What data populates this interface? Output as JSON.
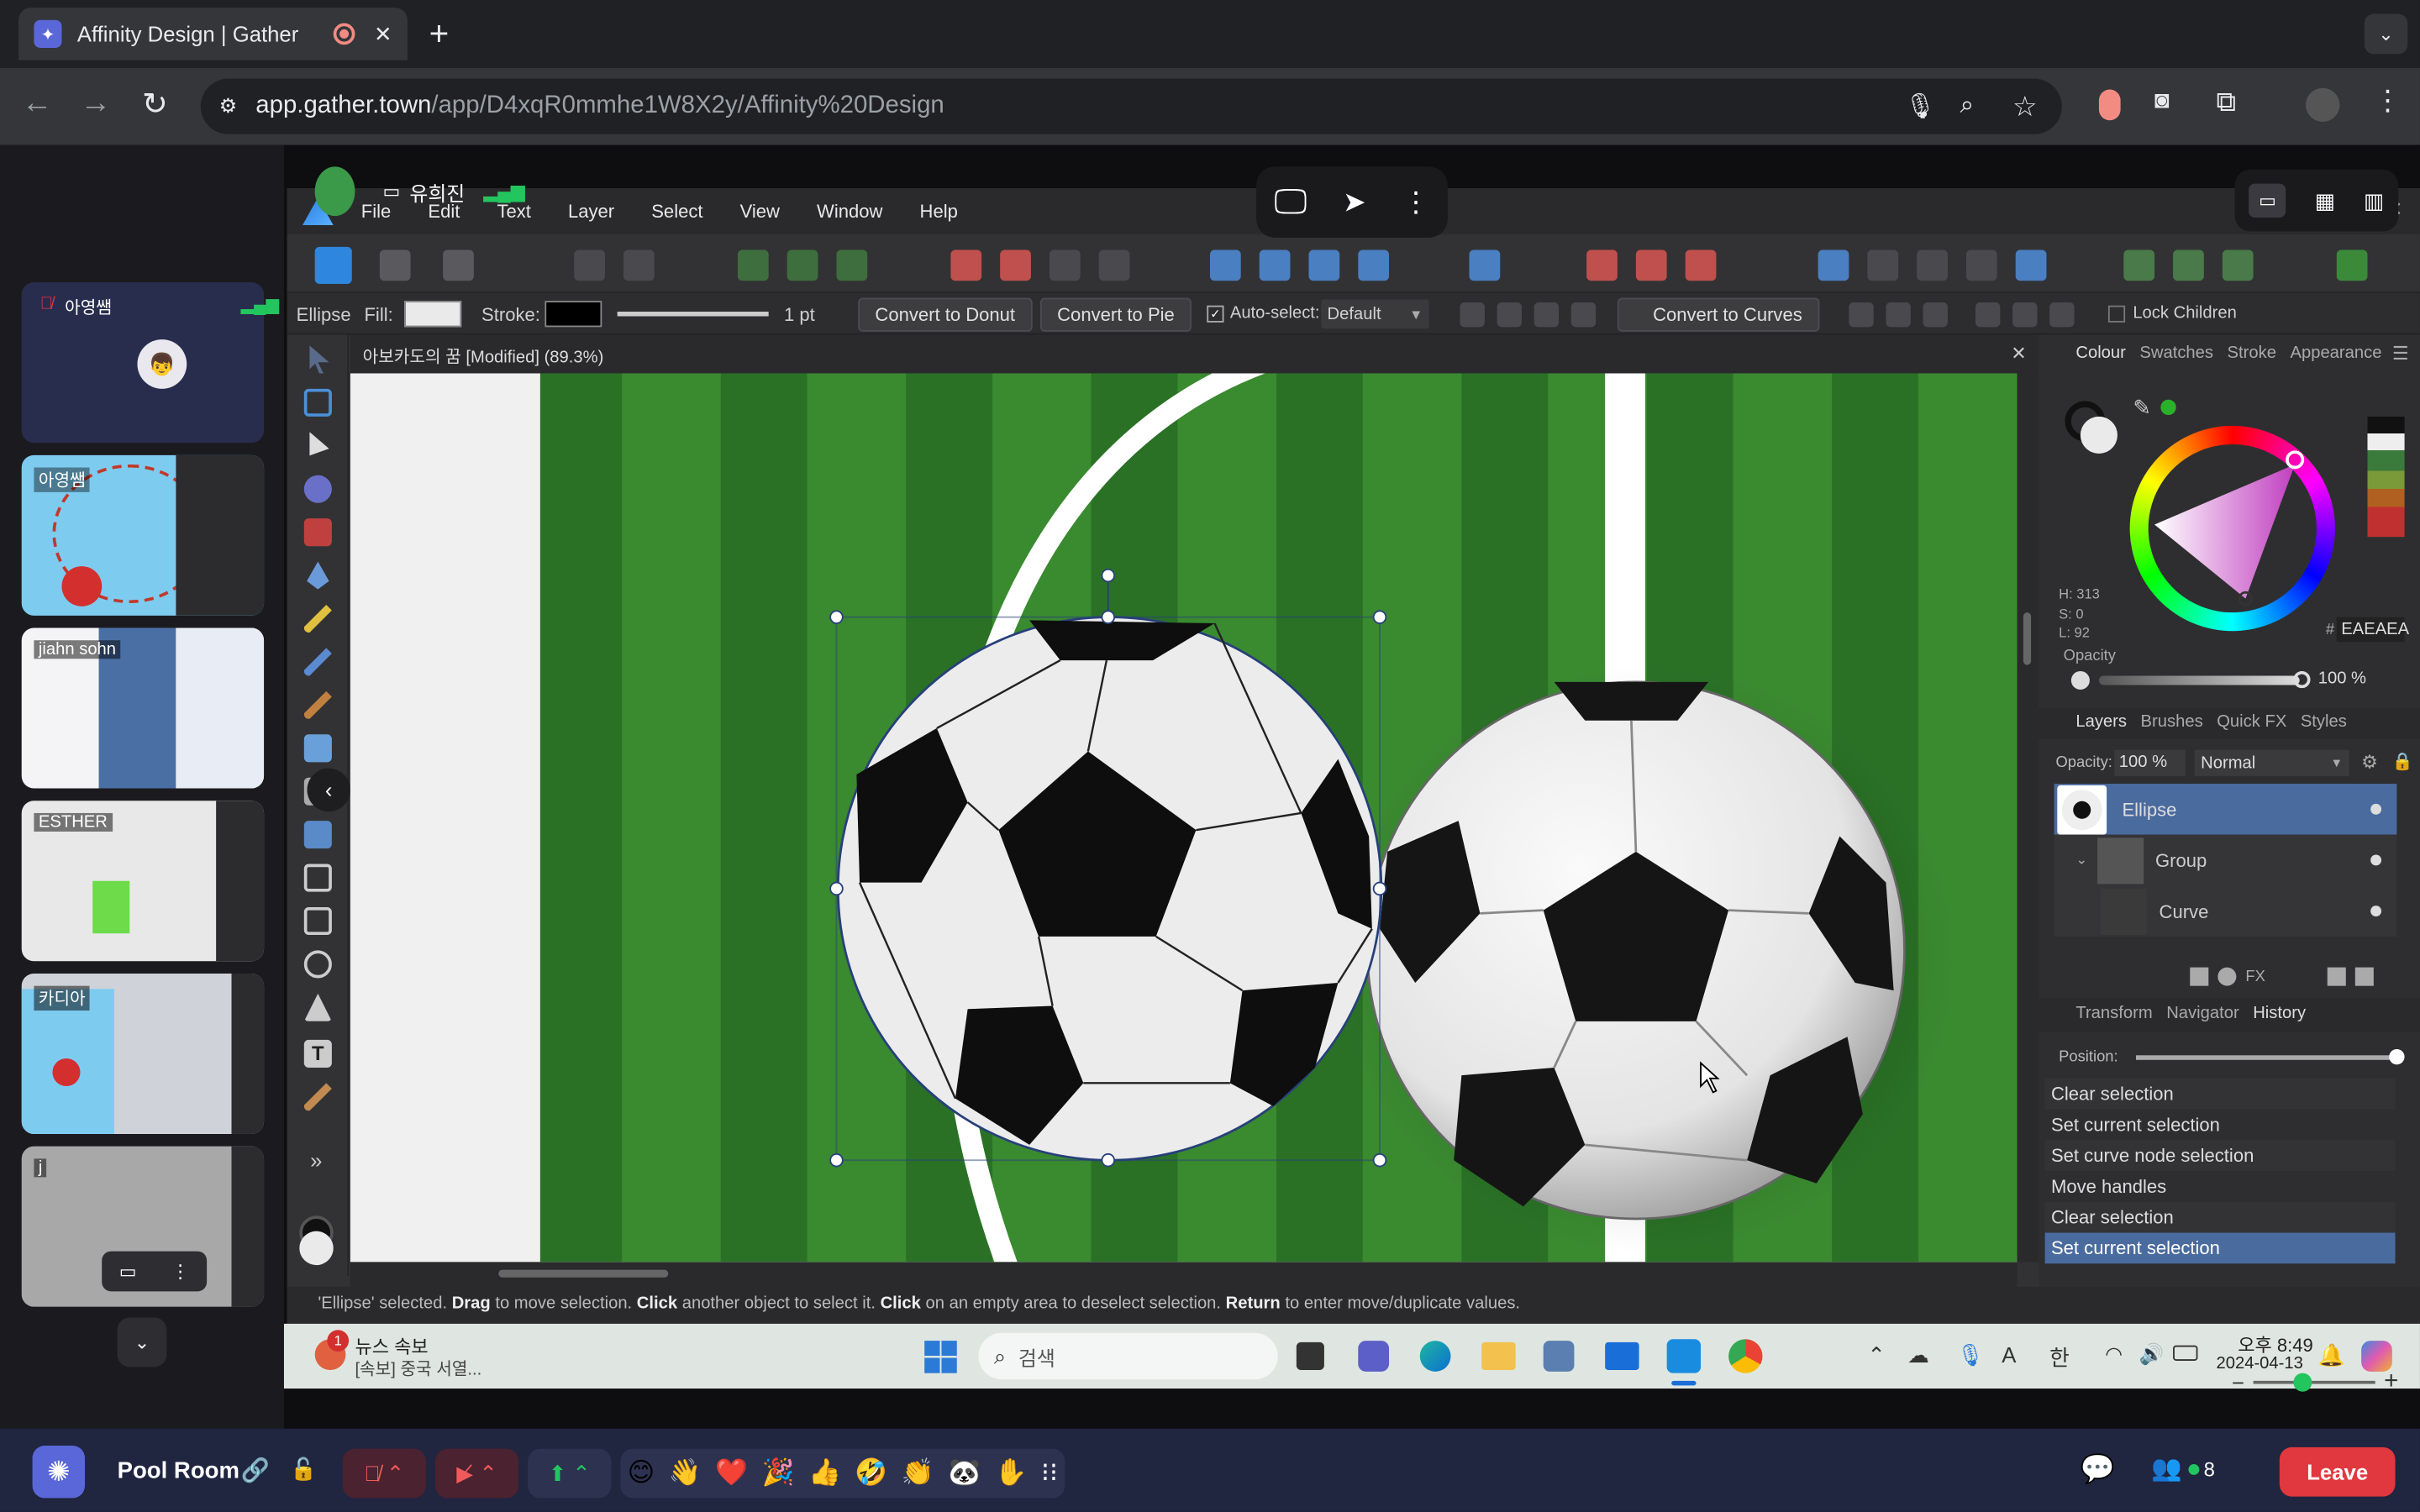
{
  "browser": {
    "tab_title": "Affinity Design | Gather",
    "url_host": "app.gather.town",
    "url_path": "/app/D4xqR0mmhe1W8X2y/Affinity%20Design"
  },
  "share": {
    "presenter": "유희진"
  },
  "menu": [
    "File",
    "Edit",
    "Text",
    "Layer",
    "Select",
    "View",
    "Window",
    "Help"
  ],
  "context": {
    "tool": "Ellipse",
    "fill": "Fill:",
    "stroke": "Stroke:",
    "width": "1 pt",
    "convert_donut": "Convert to Donut",
    "convert_pie": "Convert to Pie",
    "auto_select": "Auto-select:",
    "auto_select_value": "Default",
    "convert_curves": "Convert to Curves",
    "lock_children": "Lock Children"
  },
  "document": {
    "title": "아보카도의 꿈 [Modified] (89.3%)"
  },
  "colour_panel": {
    "tabs": [
      "Colour",
      "Swatches",
      "Stroke",
      "Appearance"
    ],
    "h": "H: 313",
    "s": "S: 0",
    "l": "L: 92",
    "hex_label": "#",
    "hex": "EAEAEA",
    "opacity_label": "Opacity",
    "opacity": "100 %"
  },
  "layers_panel": {
    "tabs": [
      "Layers",
      "Brushes",
      "Quick FX",
      "Styles"
    ],
    "opacity_label": "Opacity:",
    "opacity": "100 %",
    "blend": "Normal",
    "items": [
      "Ellipse",
      "Group",
      "Curve"
    ]
  },
  "history_panel": {
    "tabs": [
      "Transform",
      "Navigator",
      "History"
    ],
    "position": "Position:",
    "items": [
      "Clear selection",
      "Set current selection",
      "Set curve node selection",
      "Move handles",
      "Clear selection",
      "Set current selection"
    ]
  },
  "status": {
    "p1": "'Ellipse' selected. ",
    "b1": "Drag",
    "p2": " to move selection. ",
    "b2": "Click",
    "p3": " another object to select it. ",
    "b3": "Click",
    "p4": " on an empty area to deselect selection. ",
    "b4": "Return",
    "p5": " to enter move/duplicate values."
  },
  "taskbar": {
    "news_title": "뉴스 속보",
    "news_sub": "[속보] 중국 서열...",
    "news_badge": "1",
    "search": "검색",
    "time": "오후 8:49",
    "date": "2024-04-13",
    "ime1": "A",
    "ime2": "한"
  },
  "participants": [
    {
      "name": "아영쌤"
    },
    {
      "name": "아영쌤"
    },
    {
      "name": "jiahn sohn"
    },
    {
      "name": "ESTHER"
    },
    {
      "name": "카디아"
    },
    {
      "name": "j"
    }
  ],
  "gather": {
    "room": "Pool Room",
    "count": "8",
    "leave": "Leave"
  },
  "colors": {
    "accent": "#5b8ed6",
    "canvas_green": "#2f7d2a",
    "gather_red": "#e0383e",
    "gather_bg": "#282d4e"
  }
}
